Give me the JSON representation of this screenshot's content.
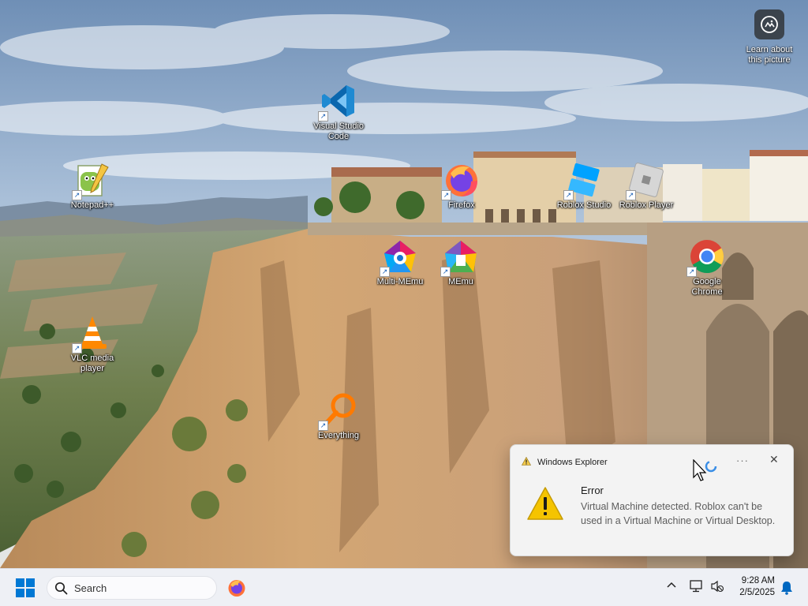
{
  "desktop": {
    "icons": [
      {
        "id": "vscode",
        "label_l1": "Visual Studio",
        "label_l2": "Code"
      },
      {
        "id": "notepadpp",
        "label_l1": "Notepad++"
      },
      {
        "id": "firefox",
        "label_l1": "Firefox"
      },
      {
        "id": "roblox-studio",
        "label_l1": "Roblox Studio"
      },
      {
        "id": "roblox-player",
        "label_l1": "Roblox Player"
      },
      {
        "id": "multi-memu",
        "label_l1": "Multi-MEmu"
      },
      {
        "id": "memu",
        "label_l1": "MEmu"
      },
      {
        "id": "chrome",
        "label_l1": "Google",
        "label_l2": "Chrome"
      },
      {
        "id": "vlc",
        "label_l1": "VLC media",
        "label_l2": "player"
      },
      {
        "id": "everything",
        "label_l1": "Everything"
      }
    ],
    "learn_about_picture": {
      "line1": "Learn about",
      "line2": "this picture"
    }
  },
  "notification": {
    "app_name": "Windows Explorer",
    "more_label": "···",
    "close_label": "✕",
    "title": "Error",
    "message": "Virtual Machine detected. Roblox can't be used in a Virtual Machine or Virtual Desktop."
  },
  "taskbar": {
    "search_placeholder": "Search",
    "clock_time": "9:28 AM",
    "clock_date": "2/5/2025",
    "tray_overflow": "^"
  },
  "colors": {
    "taskbar_bg": "#eef0f5",
    "accent_blue": "#0067c0",
    "warning_yellow": "#f2c94c",
    "toast_bg": "#f3f3f3"
  },
  "icons_semantic": [
    "windows-start-icon",
    "search-icon",
    "firefox-icon",
    "chevron-up-icon",
    "network-icon",
    "volume-muted-icon",
    "notification-bell-icon",
    "warning-icon",
    "close-icon",
    "more-icon",
    "camera-icon"
  ]
}
